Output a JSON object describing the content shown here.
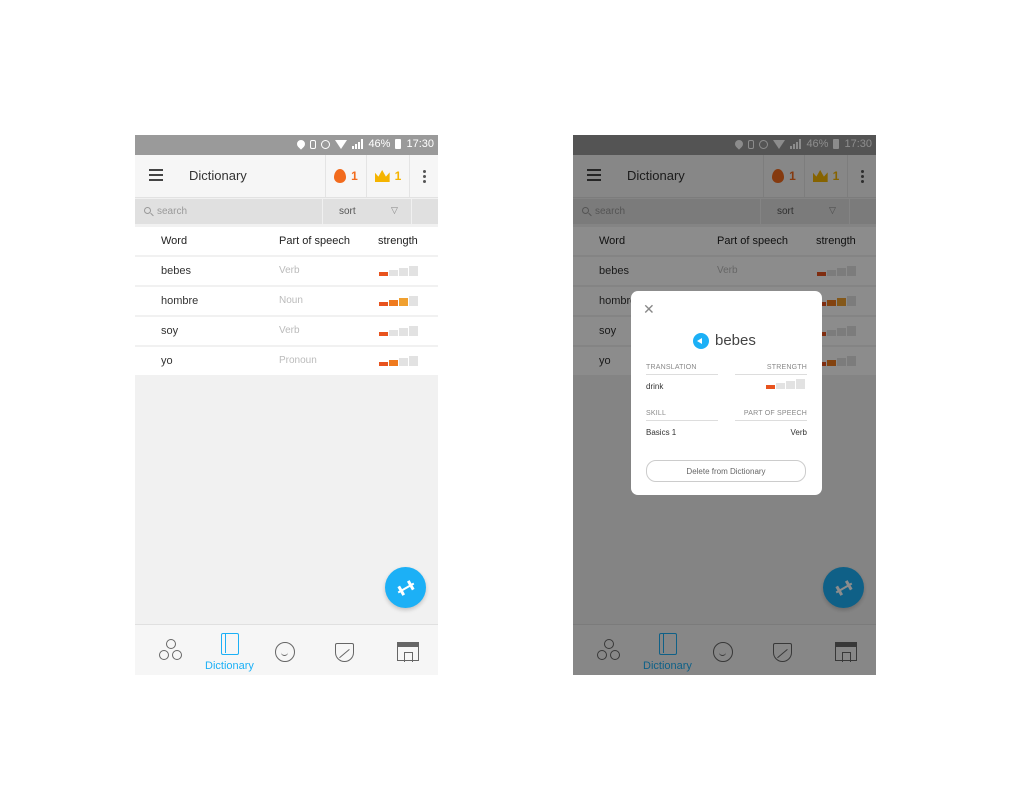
{
  "status": {
    "battery": "46%",
    "time": "17:30"
  },
  "header": {
    "title": "Dictionary",
    "streak_count": "1",
    "crown_count": "1"
  },
  "search": {
    "placeholder": "search",
    "sort_label": "sort"
  },
  "table": {
    "columns": [
      "Word",
      "Part of speech",
      "strength"
    ],
    "rows": [
      {
        "word": "bebes",
        "pos": "Verb",
        "strength": 1
      },
      {
        "word": "hombre",
        "pos": "Noun",
        "strength": 3
      },
      {
        "word": "soy",
        "pos": "Verb",
        "strength": 1
      },
      {
        "word": "yo",
        "pos": "Pronoun",
        "strength": 2
      }
    ]
  },
  "nav": {
    "active_label": "Dictionary"
  },
  "modal": {
    "word": "bebes",
    "translation_label": "TRANSLATION",
    "translation": "drink",
    "strength_label": "STRENGTH",
    "strength": 1,
    "skill_label": "SKILL",
    "skill": "Basics 1",
    "pos_label": "PART OF SPEECH",
    "pos": "Verb",
    "delete_label": "Delete from Dictionary"
  },
  "colors": {
    "accent": "#1cb0f6",
    "streak": "#f26b1d",
    "crown": "#f5b400",
    "strength_on": "#e8531e",
    "strength_off": "#e2e2e2"
  }
}
